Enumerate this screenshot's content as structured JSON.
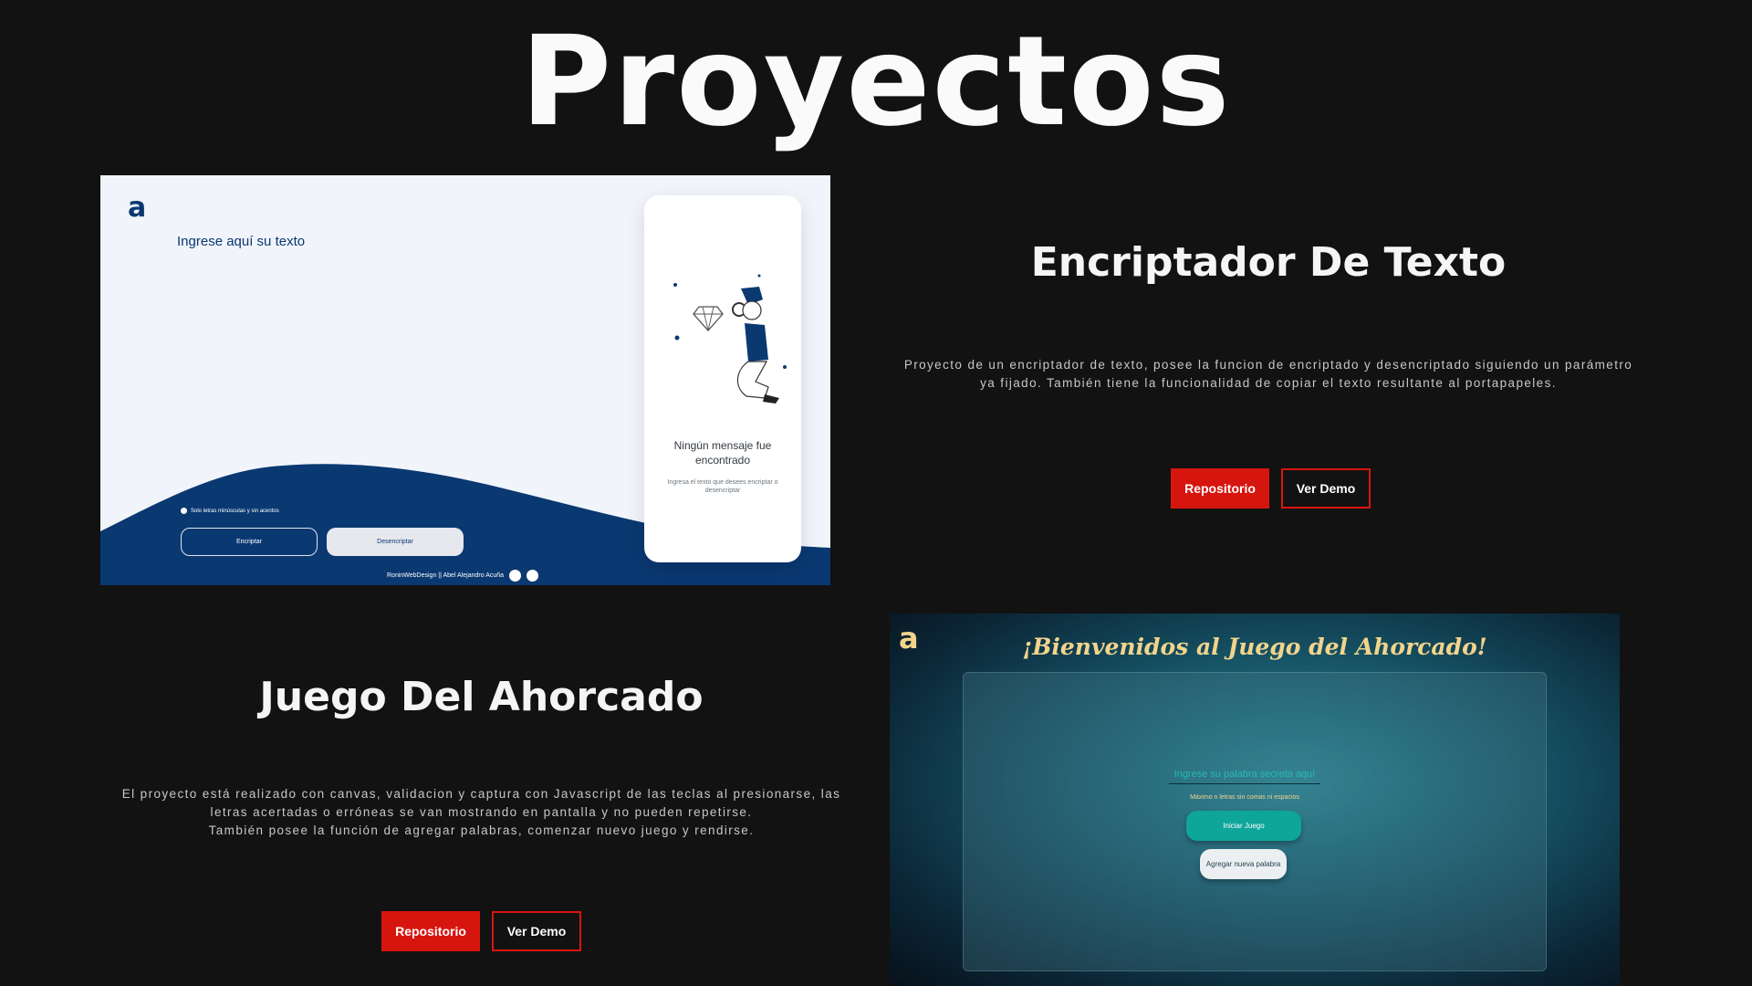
{
  "page": {
    "title": "Proyectos"
  },
  "projects": [
    {
      "title": "Encriptador De Texto",
      "description_lines": [
        "Proyecto de un encriptador de texto, posee la funcion de encriptado y desencriptado siguiendo un parámetro",
        "ya fijado. También tiene la funcionalidad de copiar el texto resultante al portapapeles."
      ],
      "repo_label": "Repositorio",
      "demo_label": "Ver Demo",
      "preview": {
        "logo": "a",
        "input_placeholder": "Ingrese aquí su texto",
        "hint": "Solo letras minúsculas y sin acentos",
        "encrypt_label": "Encriptar",
        "decrypt_label": "Desencriptar",
        "footer": "RoninWebDesign || Abel Alejandro Acuña",
        "empty_title": "Ningún mensaje fue encontrado",
        "empty_sub": "Ingresa el texto que desees encriptar o desencriptar",
        "icons": [
          "github-icon",
          "facebook-icon"
        ]
      }
    },
    {
      "title": "Juego Del Ahorcado",
      "description_lines": [
        "El proyecto está realizado con canvas, validacion y captura con Javascript de las teclas al presionarse, las",
        "letras acertadas o erróneas se van mostrando en pantalla y no pueden repetirse.",
        "También posee la función de agregar palabras, comenzar nuevo juego y rendirse."
      ],
      "repo_label": "Repositorio",
      "demo_label": "Ver Demo",
      "preview": {
        "logo": "a",
        "heading": "¡Bienvenidos al Juego del Ahorcado!",
        "input_placeholder": "Ingrese su palabra secreta aquí",
        "hint": "Máximo n letras sin comas ni espacios",
        "start_label": "Iniciar Juego",
        "add_word_label": "Agregar nueva palabra"
      }
    }
  ],
  "colors": {
    "background": "#121212",
    "accent_red": "#d7150f",
    "encriptador_blue": "#0a3871",
    "ahorcado_gold": "#f2d48c",
    "ahorcado_teal": "#0ea59a"
  }
}
